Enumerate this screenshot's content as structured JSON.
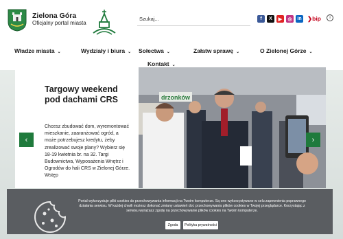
{
  "header": {
    "title": "Zielona Góra",
    "subtitle": "Oficjalny portal miasta",
    "search_label": "Szukaj...",
    "bip_label": "bip",
    "socials": [
      "f",
      "X",
      "▶",
      "◎",
      "in"
    ]
  },
  "nav": {
    "items": [
      {
        "label": "Władze miasta"
      },
      {
        "label": "Wydziały i biura"
      },
      {
        "label": "Sołectwa"
      },
      {
        "label": "Załatw sprawę"
      },
      {
        "label": "O Zielonej Górze"
      },
      {
        "label": "Kontakt"
      }
    ]
  },
  "slide": {
    "title": "Targowy weekend pod dachami CRS",
    "body": "Chcesz zbudować dom, wyremontować mieszkanie, zaaranżować ogród, a może potrzebujesz kredytu, żeby zrealizować swoje plany? Wybierz się 18-19 kwietnia br. na 32. Targi Budownictwa, Wyposażenia Wnętrz i Ogrodów do hali CRS w Zielonej Górze. Wstęp",
    "photo_banner": "drzonków"
  },
  "cookie": {
    "text": "Portal wykorzystuje pliki cookies do przechowywania informacji na Twoim komputerze. Są one wykorzystywane w celu zapewnienia poprawnego działania serwisu. W każdej chwili możesz dokonać zmiany ustawień dot. przechowywania plików cookies w Twojej przeglądarce. Korzystając z serwisu wyrażasz zgodę na przechowywanie plików cookies na Twoim komputerze.",
    "accept_label": "Zgoda",
    "privacy_label": "Polityka prywatności"
  },
  "colors": {
    "brand_green": "#1f7a3c",
    "cookie_bg": "#5a5d61",
    "bip_red": "#c3001a"
  }
}
